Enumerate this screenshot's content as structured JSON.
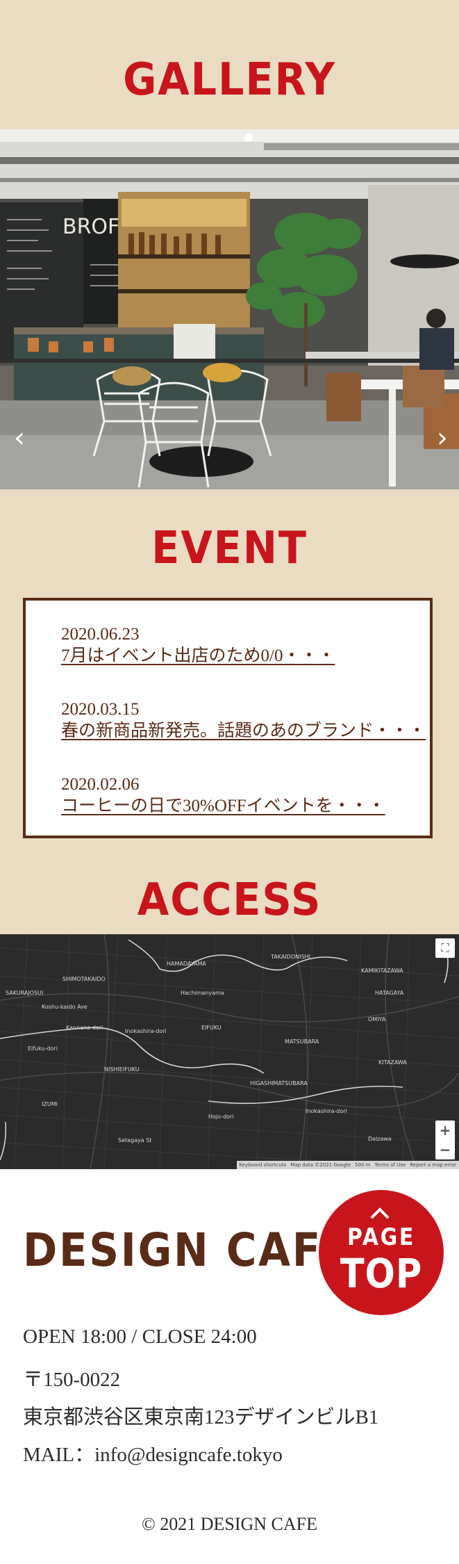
{
  "sections": {
    "gallery_title": "GALLERY",
    "event_title": "EVENT",
    "access_title": "ACCESS"
  },
  "gallery": {
    "prev_icon": "chevron-left-icon",
    "next_icon": "chevron-right-icon",
    "chalkboard_text": "BROFE"
  },
  "events": [
    {
      "date": "2020.06.23",
      "title": "7月はイベント出店のため0/0・・・"
    },
    {
      "date": "2020.03.15",
      "title": "春の新商品新発売。話題のあのブランド・・・"
    },
    {
      "date": "2020.02.06",
      "title": "コーヒーの日で30%OFFイベントを・・・"
    }
  ],
  "map": {
    "labels": [
      "HAMADAYAMA",
      "TAKAIDONISHI",
      "SAKURAJOSUI",
      "SHIMOTAKAIDO",
      "EIFUKU",
      "NISHIEIFUKU",
      "MATSUBARA",
      "OMIYA",
      "IZUMI",
      "Kannana-dori",
      "Koshu-kaido Ave",
      "Inokashira-dori",
      "Hojo-dori",
      "HIGASHIMATSUBARA",
      "KITAZAWA",
      "HATAGAYA",
      "Hachimanyama",
      "Eifuku-dori",
      "KAMIKITAZAWA",
      "Setagaya St",
      "Daizawa",
      "Inokashira-dori"
    ],
    "footer": {
      "shortcuts": "Keyboard shortcuts",
      "data": "Map data ©2021 Google",
      "scale": "500 m",
      "terms": "Terms of Use",
      "report": "Report a map error"
    },
    "zoom_in": "+",
    "zoom_out": "−",
    "fullscreen_icon": "fullscreen-icon"
  },
  "footer": {
    "logo": "DESIGN CAFE",
    "page_top_line1": "PAGE",
    "page_top_line2": "TOP",
    "hours": "OPEN 18:00 / CLOSE 24:00",
    "postal": "〒150-0022",
    "address": "東京都渋谷区東京南123デザインビルB1",
    "mail": "MAIL：info@designcafe.tokyo",
    "copyright": "© 2021 DESIGN CAFE"
  },
  "colors": {
    "background": "#e9dcc2",
    "accent_red": "#c8151b",
    "brown": "#5a2b17",
    "map_dark": "#2b2b2b"
  }
}
